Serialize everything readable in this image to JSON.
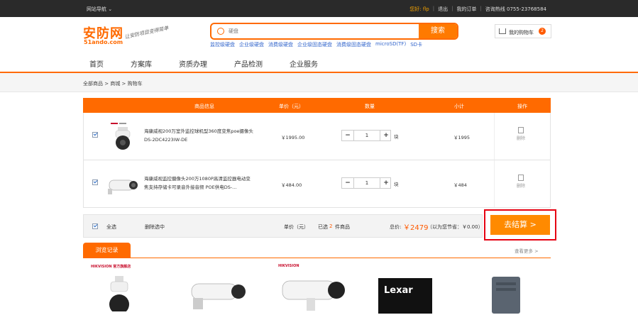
{
  "topbar": {
    "site_nav": "网站导航 ⌄",
    "greeting": "您好: flp",
    "logout": "退出",
    "my_orders": "我的订单",
    "hotline": "咨询热线 0755-23768584"
  },
  "logo": {
    "main": "安防网",
    "sub": "51ando.com",
    "slogan": "让安防项目变得简单"
  },
  "search": {
    "placeholder": "硬盘",
    "button": "搜索",
    "hotwords": [
      "监控级硬盘",
      "企业级硬盘",
      "消费级硬盘",
      "企业级固态硬盘",
      "消费级固态硬盘",
      "microSD(TF)",
      "SD卡"
    ]
  },
  "cart_button": {
    "label": "我的购物车",
    "count": "2"
  },
  "main_nav": [
    "首页",
    "方案库",
    "资质办理",
    "产品检测",
    "企业服务"
  ],
  "breadcrumb": "全部商品 > 商城 > 购物车",
  "table_headers": {
    "info": "商品信息",
    "price": "单价（元）",
    "qty": "数量",
    "subtotal": "小计",
    "ops": "操作"
  },
  "items": [
    {
      "brand": "HIKVISION",
      "name": "海康威视200万室外监控球机型360度变焦poe摄像头DS-2DC4223IW-DE",
      "price": "￥1995.00",
      "qty": "1",
      "unit": "块",
      "subtotal": "￥1995",
      "delete": "删除"
    },
    {
      "brand": "",
      "name": "海康威视监控摄像头200万1080P高清监控器电动变焦支持存储卡可录音外接音频 POE供电DS-...",
      "price": "￥484.00",
      "qty": "1",
      "unit": "块",
      "subtotal": "￥484",
      "delete": "删除"
    }
  ],
  "footer": {
    "select_all": "全选",
    "delete_selected": "删除选中",
    "unit_price": "单价（元）",
    "selected_prefix": "已选",
    "selected_count": "2",
    "selected_suffix": "件商品",
    "total_label": "总价:",
    "total_value": "￥2479",
    "saved": "（以为您节省：￥0.00）",
    "checkout": "去结算 >"
  },
  "history": {
    "tab": "浏览记录",
    "more": "查看更多 >",
    "items": [
      {
        "brand": "HIKVISION 官方旗舰店"
      },
      {
        "brand": ""
      },
      {
        "brand": "HIKVISION"
      },
      {
        "brand": "Lexar"
      },
      {
        "brand": ""
      }
    ]
  },
  "colors": {
    "accent": "#ff6a00",
    "checkout": "#ff8a00",
    "highlight_border": "#e60012",
    "topbar": "#2a2a2a"
  }
}
